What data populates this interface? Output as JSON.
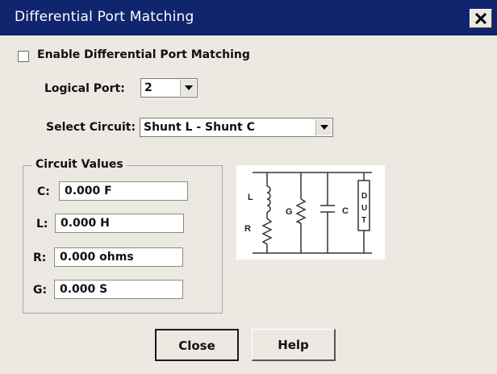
{
  "window": {
    "title": "Differential Port Matching",
    "close_glyph": "X"
  },
  "enable": {
    "label": "Enable Differential Port Matching",
    "checked": false
  },
  "logical_port": {
    "label": "Logical Port:",
    "value": "2"
  },
  "select_circuit": {
    "label": "Select Circuit:",
    "value": "Shunt L - Shunt C"
  },
  "circuit_values": {
    "title": "Circuit Values",
    "fields": [
      {
        "label": "C:",
        "value": "0.000 F"
      },
      {
        "label": "L:",
        "value": "0.000 H"
      },
      {
        "label": "R:",
        "value": "0.000 ohms"
      },
      {
        "label": "G:",
        "value": "0.000 S"
      }
    ]
  },
  "diagram": {
    "labels": {
      "L": "L",
      "R": "R",
      "G": "G",
      "C": "C",
      "dut": [
        "D",
        "U",
        "T"
      ]
    }
  },
  "buttons": {
    "close": "Close",
    "help": "Help"
  }
}
